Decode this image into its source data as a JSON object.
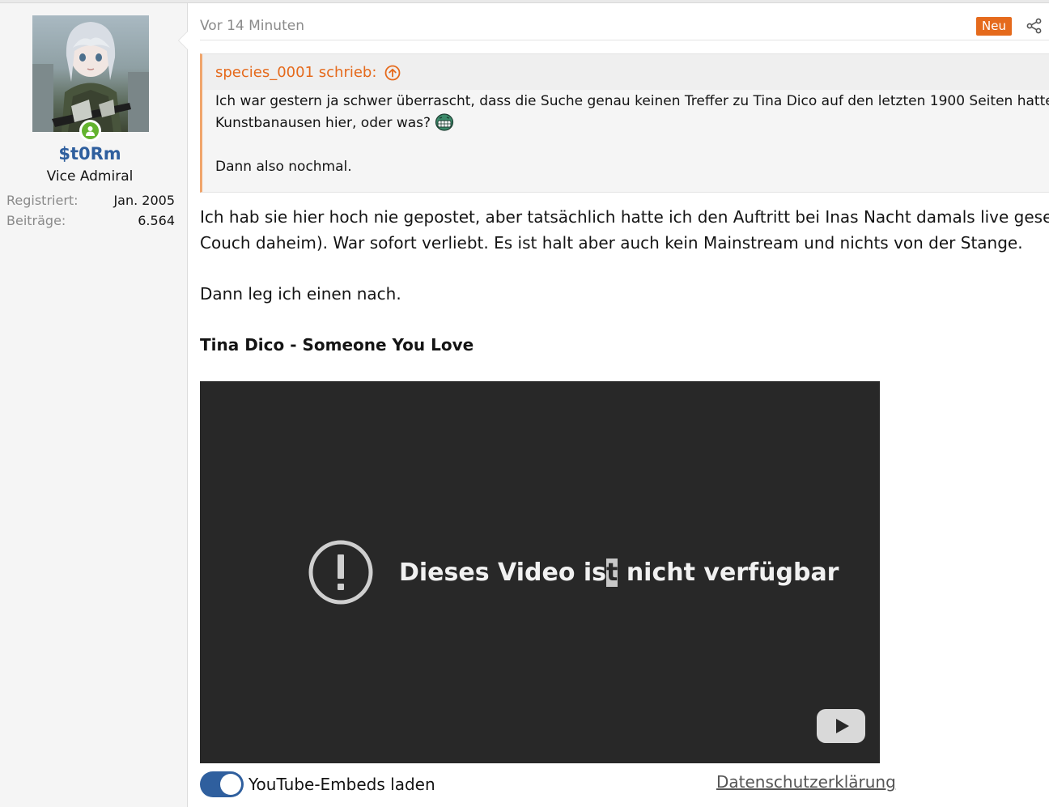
{
  "sidebar": {
    "username": "$t0Rm",
    "user_title": "Vice Admiral",
    "stats": [
      {
        "key": "Registriert:",
        "value": "Jan. 2005"
      },
      {
        "key": "Beiträge:",
        "value": "6.564"
      }
    ],
    "avatar_icon": "anime-soldier-avatar",
    "online_icon": "user-online-icon"
  },
  "post": {
    "time": "Vor 14 Minuten",
    "badge": "Neu",
    "share_icon": "share-icon",
    "quote": {
      "author": "species_0001 schrieb:",
      "jump_icon": "arrow-up-circle-icon",
      "lines": [
        "Ich war gestern ja schwer überrascht, dass die Suche genau keinen Treffer zu Tina Dico auf den letzten 1900 Seiten hatte",
        "Kunstbanausen hier, oder was?",
        "",
        "Dann also nochmal."
      ],
      "emoji": "grin-emoji"
    },
    "body": {
      "line1": "Ich hab sie hier hoch nie gepostet, aber tatsächlich hatte ich den Auftritt bei Inas Nacht damals live gesehe",
      "line2": "Couch daheim). War sofort verliebt. Es ist halt aber auch kein Mainstream und nichts von der Stange.",
      "line3": "Dann leg ich einen nach.",
      "song_title": "Tina Dico - Someone You Love"
    },
    "video": {
      "message": "Dieses Video ist nicht verfügbar",
      "message_part1": "Dieses Video is",
      "message_cursor": "t",
      "message_part2": " nicht verfügbar",
      "warning_icon": "exclamation-circle-icon",
      "logo_icon": "youtube-logo-icon"
    },
    "embed_toggle": {
      "label": "YouTube-Embeds laden",
      "state": "on",
      "accent": "#2f5f9e"
    },
    "privacy_link": "Datenschutzerklärung"
  },
  "colors": {
    "accent_orange": "#e56a1c",
    "username_blue": "#2f5f9e",
    "online_green": "#63b32e"
  }
}
